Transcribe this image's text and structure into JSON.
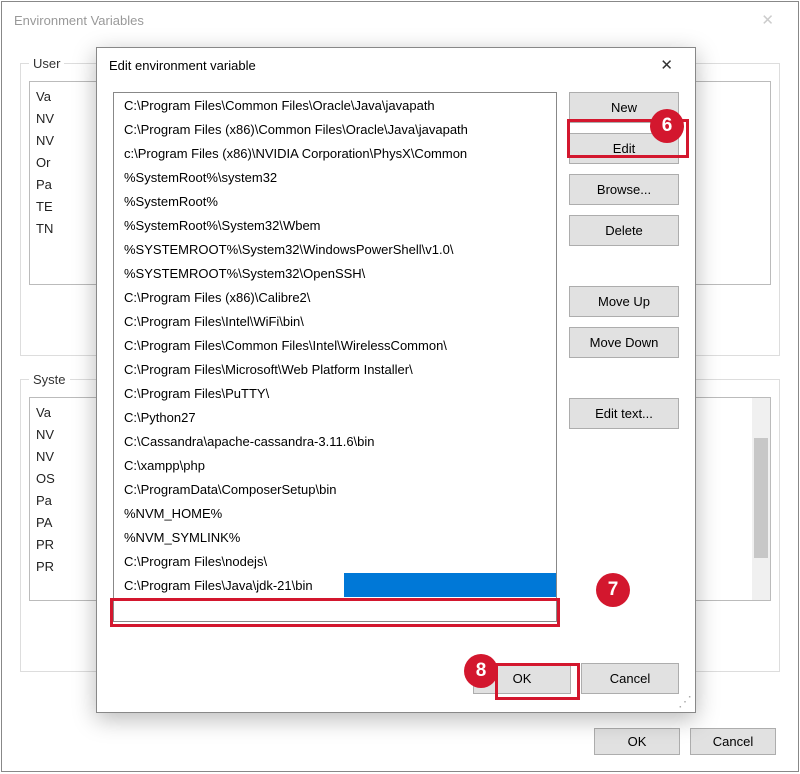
{
  "outer": {
    "title": "Environment Variables",
    "user_group_legend": "User ",
    "system_group_legend": "Syste",
    "user_vars": [
      "Va",
      "NV",
      "NV",
      "Or",
      "Pa",
      "TE",
      "TN"
    ],
    "system_vars": [
      "Va",
      "NV",
      "NV",
      "OS",
      "Pa",
      "PA",
      "PR",
      "PR"
    ],
    "ok_label": "OK",
    "cancel_label": "Cancel"
  },
  "modal": {
    "title": "Edit environment variable",
    "paths": [
      "C:\\Program Files\\Common Files\\Oracle\\Java\\javapath",
      "C:\\Program Files (x86)\\Common Files\\Oracle\\Java\\javapath",
      "c:\\Program Files (x86)\\NVIDIA Corporation\\PhysX\\Common",
      "%SystemRoot%\\system32",
      "%SystemRoot%",
      "%SystemRoot%\\System32\\Wbem",
      "%SYSTEMROOT%\\System32\\WindowsPowerShell\\v1.0\\",
      "%SYSTEMROOT%\\System32\\OpenSSH\\",
      "C:\\Program Files (x86)\\Calibre2\\",
      "C:\\Program Files\\Intel\\WiFi\\bin\\",
      "C:\\Program Files\\Common Files\\Intel\\WirelessCommon\\",
      "C:\\Program Files\\Microsoft\\Web Platform Installer\\",
      "C:\\Program Files\\PuTTY\\",
      "C:\\Python27",
      "C:\\Cassandra\\apache-cassandra-3.11.6\\bin",
      "C:\\xampp\\php",
      "C:\\ProgramData\\ComposerSetup\\bin",
      "%NVM_HOME%",
      "%NVM_SYMLINK%",
      "C:\\Program Files\\nodejs\\"
    ],
    "editing_value": "C:\\Program Files\\Java\\jdk-21\\bin",
    "buttons": {
      "new": "New",
      "edit": "Edit",
      "browse": "Browse...",
      "delete": "Delete",
      "move_up": "Move Up",
      "move_down": "Move Down",
      "edit_text": "Edit text...",
      "ok": "OK",
      "cancel": "Cancel"
    }
  },
  "annotations": {
    "six": "6",
    "seven": "7",
    "eight": "8"
  }
}
